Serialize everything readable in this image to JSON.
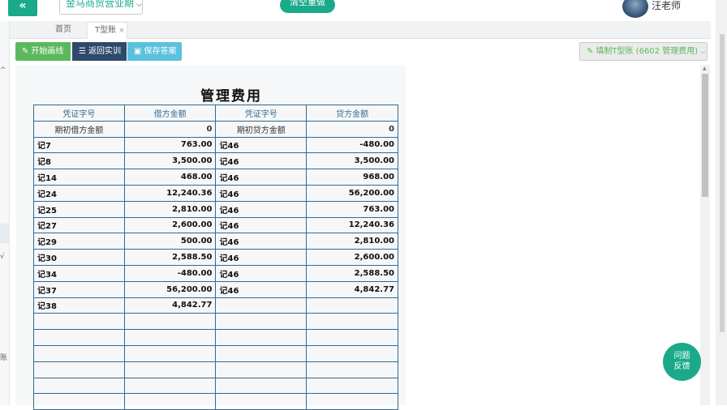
{
  "header": {
    "collapse_icon": "«",
    "period_label": "金马商贸营业期",
    "reset_label": "清空重做",
    "username": "汪老师"
  },
  "tabs": [
    {
      "label": "首页"
    },
    {
      "label": "T型账",
      "close": "×"
    }
  ],
  "toolbar": {
    "start_label": "开始画线",
    "return_label": "返回实训",
    "save_label": "保存答案",
    "fill_label": "填制T型账 (6602 管理费用)"
  },
  "ledger": {
    "title": "管理费用",
    "headers": [
      "凭证字号",
      "借方金额",
      "凭证字号",
      "贷方金额"
    ],
    "opening": {
      "debit_label": "期初借方金额",
      "debit_value": "0",
      "credit_label": "期初贷方金额",
      "credit_value": "0"
    },
    "rows": [
      {
        "dv": "记7",
        "da": "763.00",
        "cv": "记46",
        "ca": "-480.00"
      },
      {
        "dv": "记8",
        "da": "3,500.00",
        "cv": "记46",
        "ca": "3,500.00"
      },
      {
        "dv": "记14",
        "da": "468.00",
        "cv": "记46",
        "ca": "968.00"
      },
      {
        "dv": "记24",
        "da": "12,240.36",
        "cv": "记46",
        "ca": "56,200.00"
      },
      {
        "dv": "记25",
        "da": "2,810.00",
        "cv": "记46",
        "ca": "763.00"
      },
      {
        "dv": "记27",
        "da": "2,600.00",
        "cv": "记46",
        "ca": "12,240.36"
      },
      {
        "dv": "记29",
        "da": "500.00",
        "cv": "记46",
        "ca": "2,810.00"
      },
      {
        "dv": "记30",
        "da": "2,588.50",
        "cv": "记46",
        "ca": "2,600.00"
      },
      {
        "dv": "记34",
        "da": "-480.00",
        "cv": "记46",
        "ca": "2,588.50"
      },
      {
        "dv": "记37",
        "da": "56,200.00",
        "cv": "记46",
        "ca": "4,842.77"
      },
      {
        "dv": "记38",
        "da": "4,842.77",
        "cv": "",
        "ca": ""
      },
      {
        "dv": "",
        "da": "",
        "cv": "",
        "ca": ""
      },
      {
        "dv": "",
        "da": "",
        "cv": "",
        "ca": ""
      },
      {
        "dv": "",
        "da": "",
        "cv": "",
        "ca": ""
      },
      {
        "dv": "",
        "da": "",
        "cv": "",
        "ca": ""
      },
      {
        "dv": "",
        "da": "",
        "cv": "",
        "ca": ""
      },
      {
        "dv": "",
        "da": "",
        "cv": "",
        "ca": ""
      }
    ]
  },
  "feedback": {
    "line1": "问题",
    "line2": "反馈"
  },
  "sidebar_marks": [
    "^",
    "√",
    "账"
  ],
  "colors": {
    "accent": "#1aaa8a",
    "green": "#5cb85c",
    "navy": "#2d4a6a",
    "cyan": "#5bc0de",
    "table_border": "#356a8e"
  }
}
